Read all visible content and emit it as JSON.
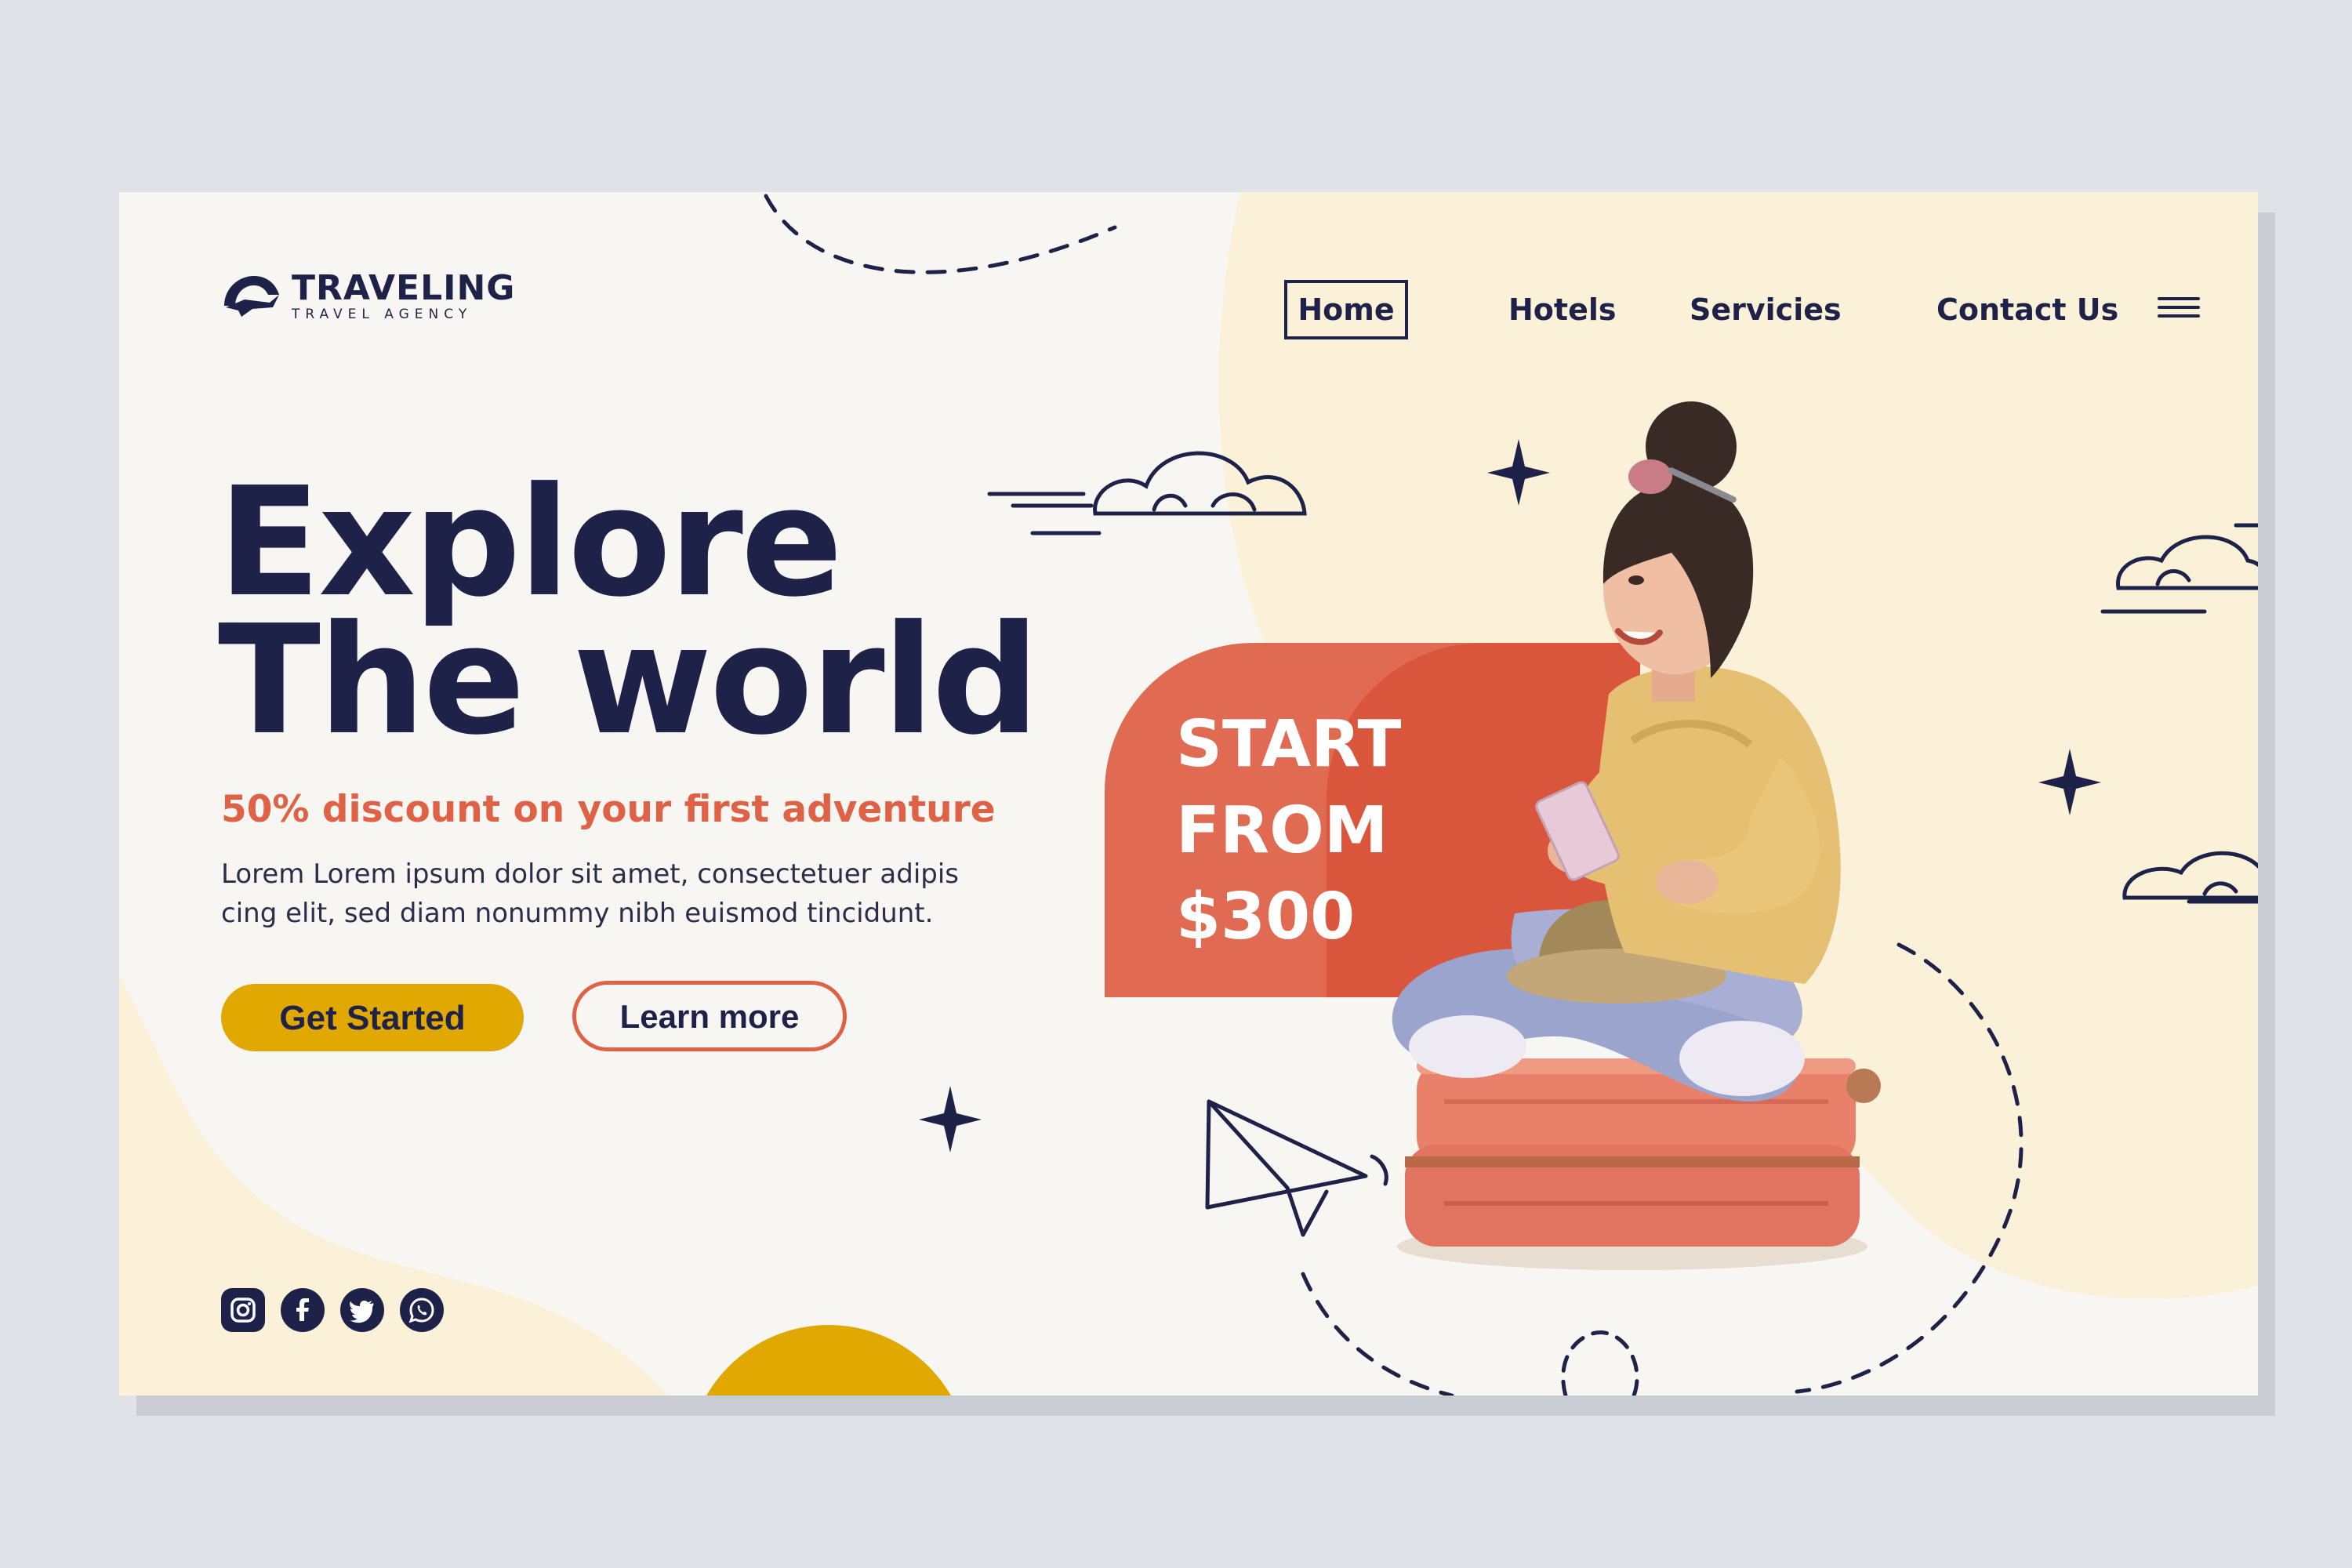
{
  "brand": {
    "name": "TRAVELING",
    "tagline": "TRAVEL AGENCY"
  },
  "nav": {
    "items": [
      "Home",
      "Hotels",
      "Servicies",
      "Contact Us"
    ],
    "active": "Home"
  },
  "hero": {
    "title_line1": "Explore",
    "title_line2": "The world",
    "discount": "50% discount on your first adventure",
    "description": "Lorem Lorem ipsum dolor sit amet, consectetuer adipis cing elit, sed diam nonummy nibh euismod tincidunt.",
    "primary_button": "Get Started",
    "secondary_button": "Learn more"
  },
  "promo": {
    "line1": "START",
    "line2": "FROM",
    "price": "$300"
  },
  "socials": [
    "instagram-icon",
    "facebook-icon",
    "twitter-icon",
    "whatsapp-icon"
  ],
  "colors": {
    "navy": "#1e2248",
    "coral": "#e06246",
    "mustard": "#e0a800",
    "cream": "#fbf0d8",
    "background": "#f8f6f2"
  }
}
